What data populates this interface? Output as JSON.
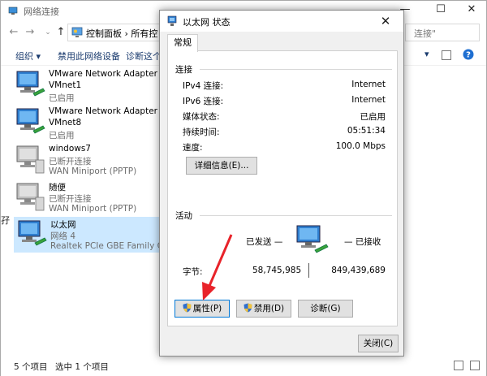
{
  "explorer": {
    "title": "网络连接",
    "address_text": "控制面板 › 所有控",
    "search_placeholder": "连接\"",
    "toolbar": {
      "organize": "组织 ▾",
      "disable": "禁用此网络设备",
      "diagnose": "诊断这个连"
    },
    "left_cut_text": "孖",
    "items": [
      {
        "l1": "VMware Network Adapter",
        "l2": "VMnet1",
        "l3": "已启用"
      },
      {
        "l1": "VMware Network Adapter",
        "l2": "VMnet8",
        "l3": "已启用"
      },
      {
        "l1": "windows7",
        "l2": "已断开连接",
        "l3": "WAN Miniport (PPTP)"
      },
      {
        "l1": "随便",
        "l2": "已断开连接",
        "l3": "WAN Miniport (PPTP)"
      },
      {
        "l1": "以太网",
        "l2": "网络 4",
        "l3": "Realtek PCIe GBE Family Contr..."
      }
    ],
    "status": {
      "count": "5 个项目",
      "selected": "选中 1 个项目"
    }
  },
  "dialog": {
    "title": "以太网 状态",
    "close_glyph": "✕",
    "tab": "常规",
    "connection": {
      "label": "连接",
      "rows": [
        {
          "k": "IPv4 连接:",
          "v": "Internet"
        },
        {
          "k": "IPv6 连接:",
          "v": "Internet"
        },
        {
          "k": "媒体状态:",
          "v": "已启用"
        },
        {
          "k": "持续时间:",
          "v": "05:51:34"
        },
        {
          "k": "速度:",
          "v": "100.0 Mbps"
        }
      ],
      "details_button": "详细信息(E)..."
    },
    "activity": {
      "label": "活动",
      "sent_label": "已发送 —",
      "recv_label": "— 已接收",
      "bytes_label": "字节:",
      "sent_value": "58,745,985",
      "recv_value": "849,439,689"
    },
    "buttons": {
      "properties": "属性(P)",
      "disable": "禁用(D)",
      "diagnose": "诊断(G)",
      "close": "关闭(C)"
    }
  },
  "colors": {
    "accent": "#0078d7",
    "selection": "#cce8ff",
    "arrow": "#e8232a"
  }
}
